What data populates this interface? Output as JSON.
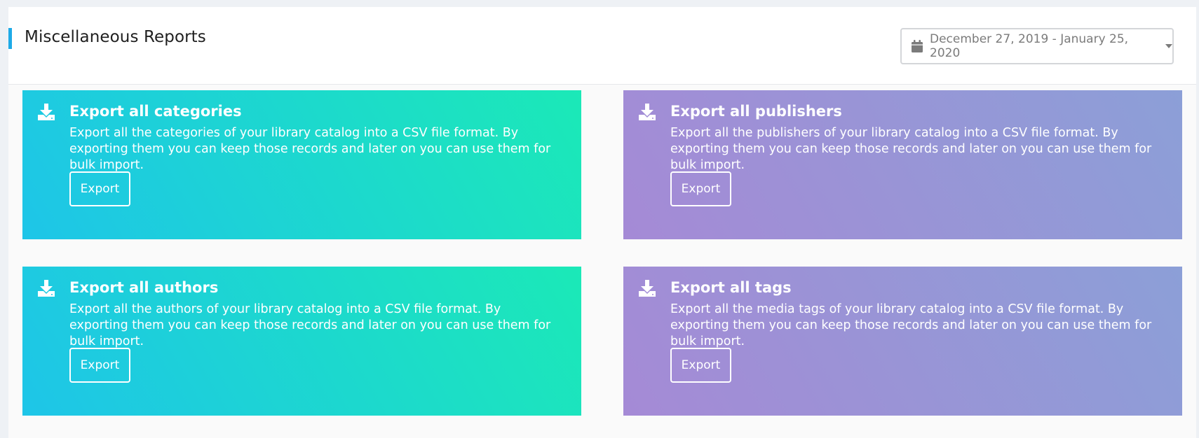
{
  "header": {
    "title": "Miscellaneous Reports",
    "date_range": "December 27, 2019 - January 25, 2020",
    "accent_color": "#1eaae7"
  },
  "cards": [
    {
      "title": "Export all categories",
      "description": "Export all the categories of your library catalog into a CSV file format. By exporting them you can keep those records and later on you can use them for bulk import.",
      "button_label": "Export",
      "theme": "teal"
    },
    {
      "title": "Export all publishers",
      "description": "Export all the publishers of your library catalog into a CSV file format. By exporting them you can keep those records and later on you can use them for bulk import.",
      "button_label": "Export",
      "theme": "purple"
    },
    {
      "title": "Export all authors",
      "description": "Export all the authors of your library catalog into a CSV file format. By exporting them you can keep those records and later on you can use them for bulk import.",
      "button_label": "Export",
      "theme": "teal"
    },
    {
      "title": "Export all tags",
      "description": "Export all the media tags of your library catalog into a CSV file format. By exporting them you can keep those records and later on you can use them for bulk import.",
      "button_label": "Export",
      "theme": "purple"
    }
  ],
  "icons": {
    "date_picker": "calendar-icon",
    "dropdown": "caret-down-icon",
    "card": "download-icon"
  },
  "colors": {
    "teal_start": "#1ec5e8",
    "teal_end": "#1be9b7",
    "purple_start": "#a58ad6",
    "purple_end": "#8c9fd7"
  }
}
